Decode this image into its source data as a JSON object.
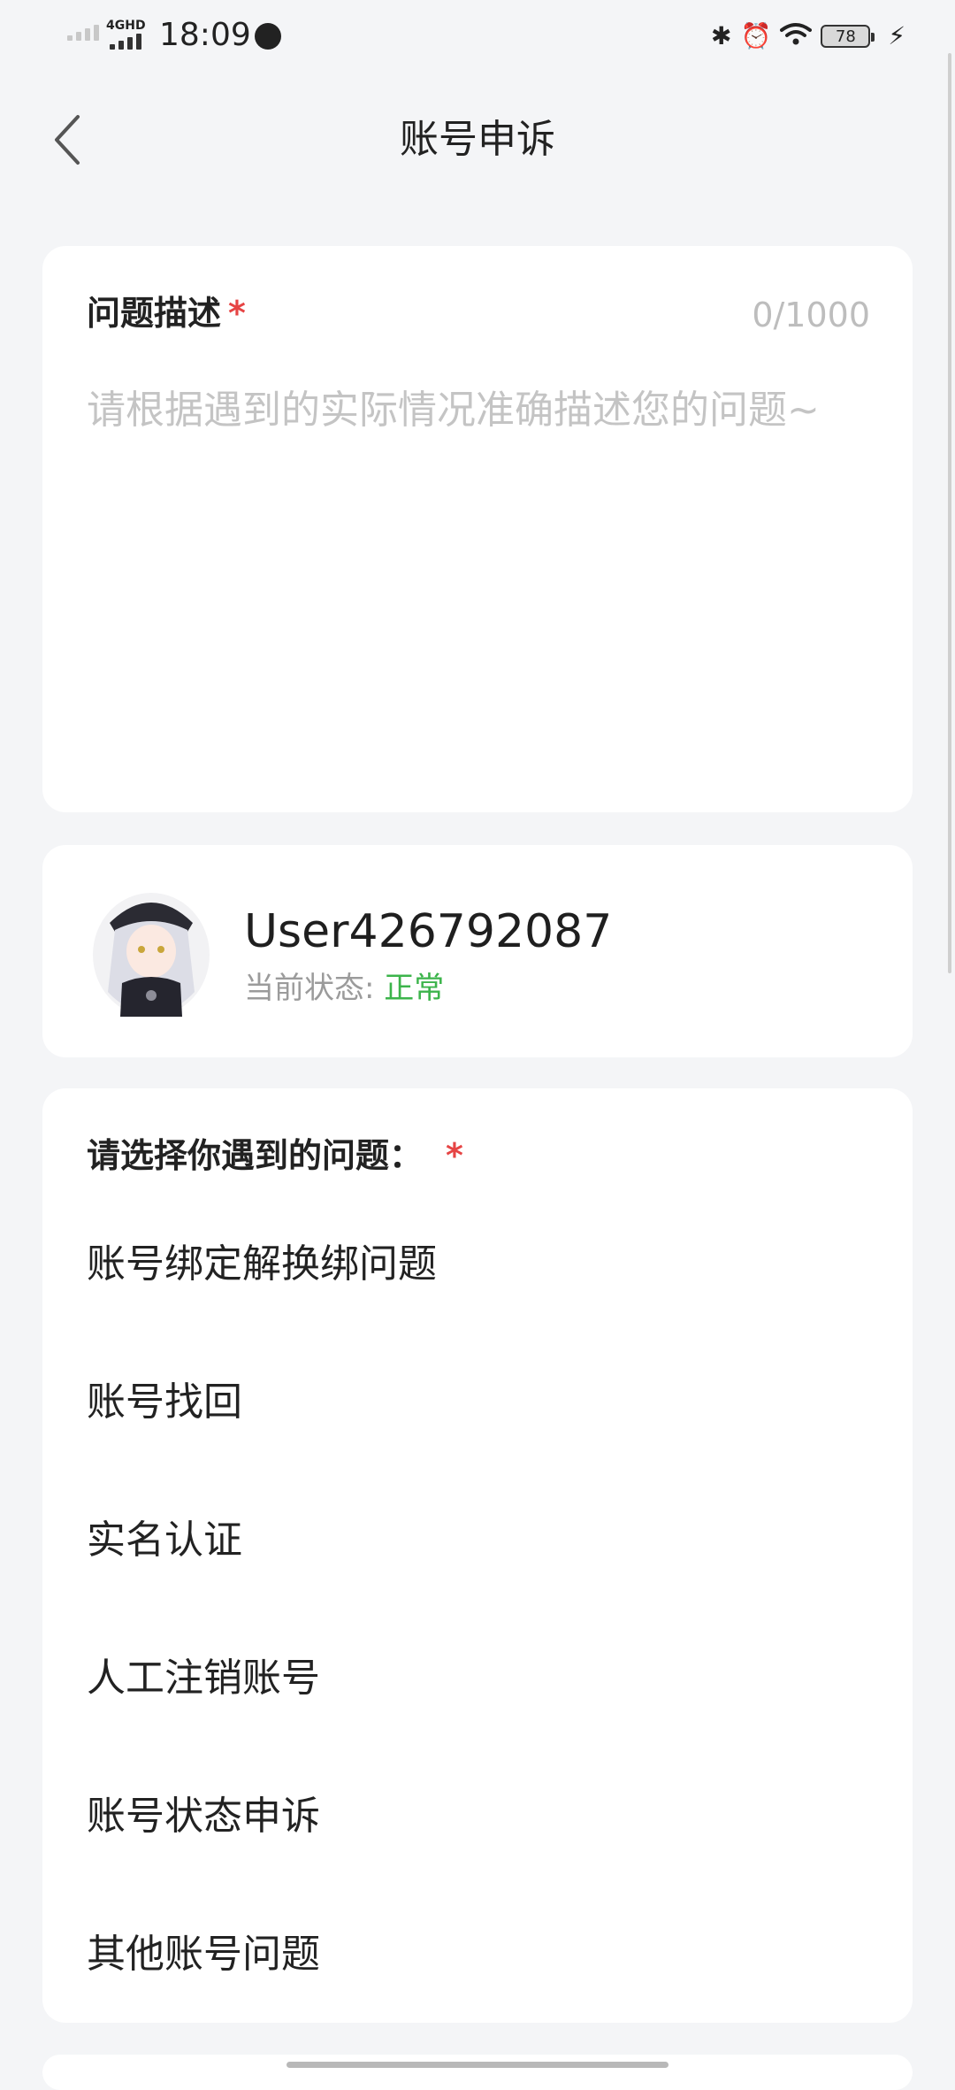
{
  "status_bar": {
    "network": "4GHD",
    "time": "18:09",
    "battery": "78"
  },
  "header": {
    "title": "账号申诉"
  },
  "description": {
    "label": "问题描述",
    "required_mark": "*",
    "counter": "0/1000",
    "placeholder": "请根据遇到的实际情况准确描述您的问题~"
  },
  "user": {
    "name": "User426792087",
    "status_label": "当前状态: ",
    "status_value": "正常"
  },
  "issues": {
    "label": "请选择你遇到的问题：",
    "required_mark": "*",
    "options": [
      "账号绑定解换绑问题",
      "账号找回",
      "实名认证",
      "人工注销账号",
      "账号状态申诉",
      "其他账号问题"
    ]
  },
  "colors": {
    "background": "#f4f5f7",
    "card": "#ffffff",
    "required": "#e64444",
    "status_ok": "#3cb44b",
    "placeholder": "#c4c4c4"
  }
}
